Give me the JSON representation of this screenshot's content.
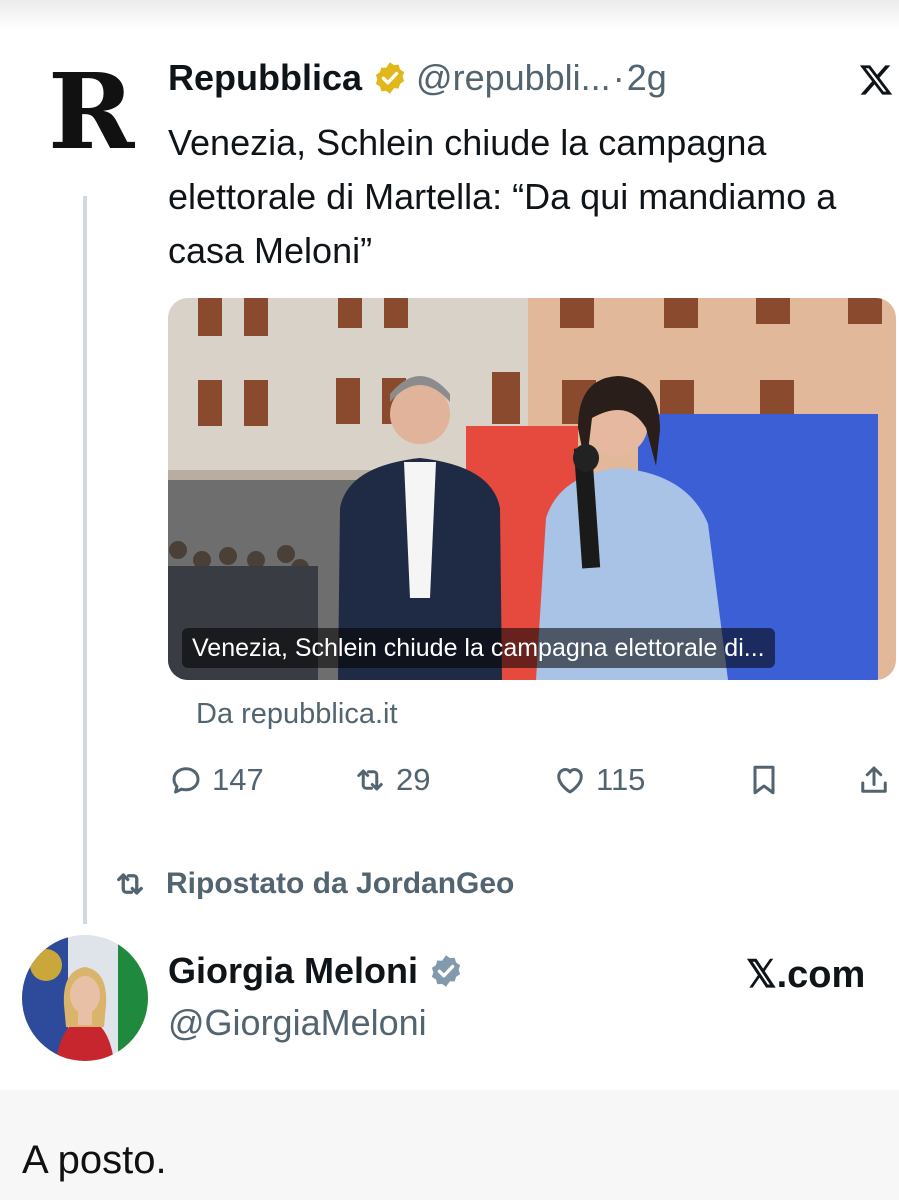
{
  "tweet": {
    "logo_letter": "R",
    "author_name": "Repubblica",
    "handle": "@repubbli...",
    "dot": "·",
    "time": "2g",
    "text": "Venezia, Schlein chiude la campagna elettorale di Martella: “Da qui mandiamo a casa Meloni”",
    "media_caption": "Venezia, Schlein chiude la campagna elettorale di...",
    "source": "Da repubblica.it",
    "counts": {
      "replies": "147",
      "reposts": "29",
      "likes": "115"
    },
    "verified_color": "#e2b719"
  },
  "repost_label": "Ripostato da JordanGeo",
  "quoted": {
    "author_name": "Giorgia Meloni",
    "handle": "@GiorgiaMeloni",
    "site": "𝕏.com",
    "verified_color": "#829aab"
  },
  "caption": "A posto.",
  "icons": [
    "x-logo-icon",
    "verified-badge-icon",
    "reply-icon",
    "repost-icon",
    "like-icon",
    "bookmark-icon",
    "share-icon"
  ]
}
